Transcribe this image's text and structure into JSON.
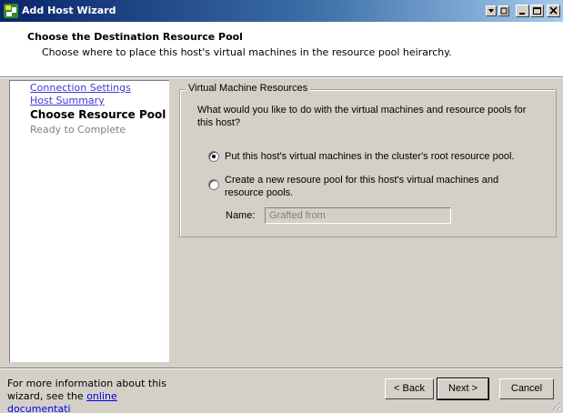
{
  "window": {
    "title": "Add Host Wizard",
    "icon": "wizard-app-icon"
  },
  "header": {
    "title": "Choose the Destination Resource Pool",
    "subtitle": "Choose where to place this host's virtual machines in the resource pool heirarchy."
  },
  "nav": {
    "items": [
      {
        "label": "Connection Settings",
        "state": "link"
      },
      {
        "label": "Host Summary",
        "state": "link"
      },
      {
        "label": "Choose Resource Pool",
        "state": "current"
      },
      {
        "label": "Ready to Complete",
        "state": "future"
      }
    ]
  },
  "main": {
    "group_title": "Virtual Machine Resources",
    "question": "What would you like to do with the virtual machines and resource pools for this host?",
    "options": [
      {
        "label": "Put this host's virtual machines in the cluster's root resource pool.",
        "selected": true
      },
      {
        "label": "Create a new resoure pool for this host's virtual machines and resource pools.",
        "selected": false
      }
    ],
    "name_label": "Name:",
    "name_value": "Grafted from"
  },
  "footer": {
    "info_prefix": "For more information about this wizard, see the",
    "info_link": "online documentati",
    "back_label": "< Back",
    "next_label": "Next >",
    "cancel_label": "Cancel"
  },
  "colors": {
    "titlebar_start": "#0a246a",
    "titlebar_end": "#a6caf0",
    "link": "#3a3ad8",
    "face": "#d4d0c8"
  }
}
